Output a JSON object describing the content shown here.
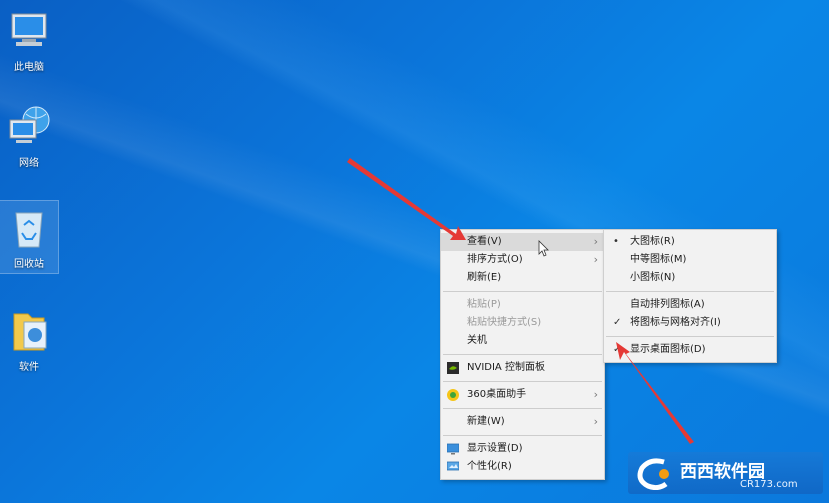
{
  "desktop": {
    "icons": [
      {
        "label": "此电脑",
        "icon": "computer-icon"
      },
      {
        "label": "网络",
        "icon": "network-icon"
      },
      {
        "label": "回收站",
        "icon": "recycle-bin-icon"
      },
      {
        "label": "软件",
        "icon": "folder-icon"
      }
    ]
  },
  "context_menu": {
    "items": [
      {
        "label": "查看(V)",
        "state": "hovered",
        "submenu": true
      },
      {
        "label": "排序方式(O)",
        "submenu": true
      },
      {
        "label": "刷新(E)"
      },
      {
        "label": "粘贴(P)",
        "disabled": true
      },
      {
        "label": "粘贴快捷方式(S)",
        "disabled": true
      },
      {
        "label": "关机"
      },
      {
        "label": "NVIDIA 控制面板",
        "icon": "nvidia-icon"
      },
      {
        "label": "360桌面助手",
        "icon": "360-icon",
        "submenu": true
      },
      {
        "label": "新建(W)",
        "submenu": true
      },
      {
        "label": "显示设置(D)",
        "icon": "display-settings-icon"
      },
      {
        "label": "个性化(R)",
        "icon": "personalize-icon"
      }
    ]
  },
  "view_submenu": {
    "items": [
      {
        "label": "大图标(R)",
        "mark": "•"
      },
      {
        "label": "中等图标(M)"
      },
      {
        "label": "小图标(N)"
      },
      {
        "label": "自动排列图标(A)"
      },
      {
        "label": "将图标与网格对齐(I)",
        "mark": "✓"
      },
      {
        "label": "显示桌面图标(D)",
        "mark": "✓"
      }
    ]
  },
  "watermark": {
    "name": "西西软件园",
    "url": "CR173.com"
  },
  "colors": {
    "desktop": "#0b74d9",
    "menu_bg": "#f2f2f2",
    "hover": "#dadada",
    "arrow_annotation": "#e53935"
  }
}
